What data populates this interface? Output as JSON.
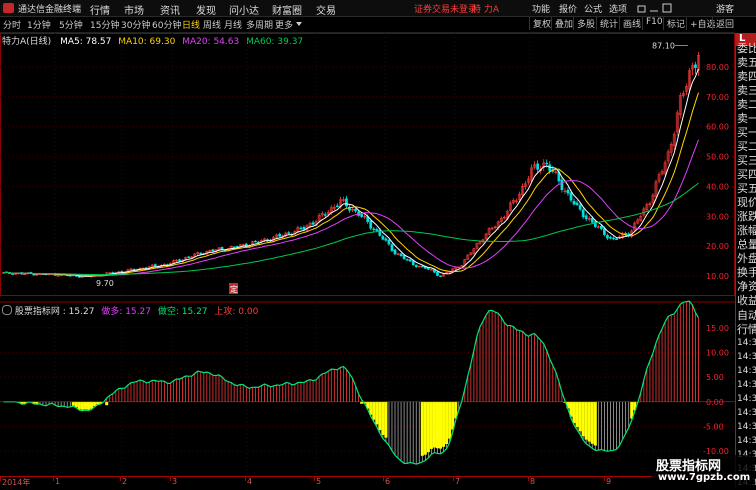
{
  "topbar": {
    "app_title": "通达信金融终端",
    "menu": [
      "行情",
      "市场",
      "资讯",
      "发现",
      "问小达",
      "财富圈",
      "交易"
    ],
    "broker_status": "证券交易未登录",
    "stock_name": "特 力A",
    "right_menu": [
      "功能",
      "报价",
      "公式",
      "选项"
    ],
    "guest": "游客"
  },
  "periods": [
    "分时",
    "1分钟",
    "5分钟",
    "15分钟",
    "30分钟",
    "60分钟",
    "日线",
    "周线",
    "月线",
    "多周期",
    "更多"
  ],
  "active_period": "日线",
  "tools": [
    "复权",
    "叠加",
    "多股",
    "统计",
    "画线",
    "F10",
    "标记",
    "+自选",
    "返回"
  ],
  "main_legend": {
    "name": "特力A",
    "period": "(日线)",
    "ma5": "MA5: 78.57",
    "ma10": "MA10: 69.30",
    "ma20": "MA20: 54.63",
    "ma60": "MA60: 39.37"
  },
  "sub_legend": {
    "name": "股票指标网",
    "value": ": 15.27",
    "duo": "做多: 15.27",
    "kong": "做空: 15.27",
    "gong": "上攻: 0.00"
  },
  "price_axis": [
    "80.00",
    "70.00",
    "60.00",
    "50.00",
    "40.00",
    "30.00",
    "20.00",
    "10.00"
  ],
  "indicator_axis": [
    "15.00",
    "10.00",
    "5.00",
    "0.00",
    "-5.00",
    "-10.00"
  ],
  "annotations": {
    "high": "87.10",
    "low": "9.70",
    "marker": "定"
  },
  "dates": [
    "2014年",
    "1",
    "2",
    "3",
    "4",
    "5",
    "6",
    "7",
    "8",
    "9"
  ],
  "sidebar": [
    "委比",
    "卖五",
    "卖四",
    "卖三",
    "卖二",
    "卖一",
    "买一",
    "买二",
    "买三",
    "买四",
    "买五",
    "现价",
    "涨跌",
    "涨幅",
    "总量",
    "外盘",
    "换手",
    "净资",
    "收益",
    "自动",
    "行情",
    "14:34",
    "14:35",
    "14:35",
    "14:35",
    "14:35",
    "14:35",
    "14:35",
    "14:35",
    "14:35",
    "14:35",
    "14:35",
    "14:35"
  ],
  "sidebar_top": "L",
  "watermark": {
    "line1": "股票指标网",
    "line2": "www.7gpzb.com"
  },
  "colors": {
    "up": "#ff3b3b",
    "down": "#00e0e0",
    "ma5": "#ffffff",
    "ma10": "#ffd400",
    "ma20": "#e040fb",
    "ma60": "#00c853",
    "indicator_line": "#00e676",
    "yellow_bar": "#ffff00"
  }
}
